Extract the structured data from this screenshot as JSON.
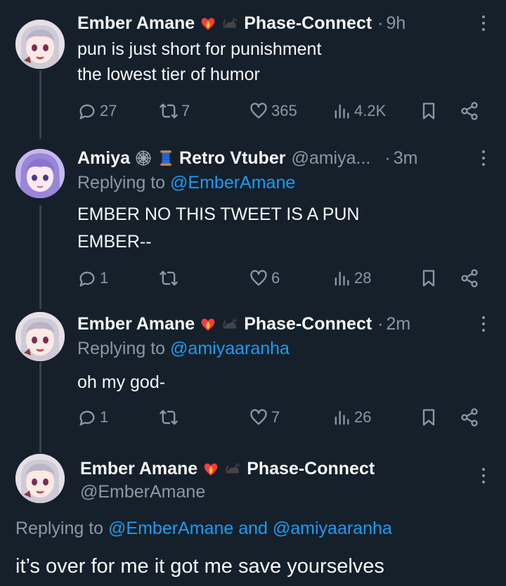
{
  "tweets": [
    {
      "name": "Ember Amane",
      "emojis": [
        "heart-fire-emoji",
        "black-cat-emoji"
      ],
      "name_suffix": "Phase-Connect",
      "handle": "",
      "time": "9h",
      "replying_to": null,
      "lines": [
        "pun is just short for punishment",
        "the lowest tier of humor"
      ],
      "stats": {
        "replies": "27",
        "retweets": "7",
        "likes": "365",
        "views": "4.2K"
      }
    },
    {
      "name": "Amiya",
      "emojis": [
        "spider-web-emoji",
        "thread-spool-emoji"
      ],
      "name_suffix": "Retro Vtuber",
      "handle": "@amiya...",
      "time": "3m",
      "replying_to": "@EmberAmane",
      "lines": [
        "EMBER NO THIS TWEET IS A PUN",
        "EMBER--"
      ],
      "stats": {
        "replies": "1",
        "retweets": "",
        "likes": "6",
        "views": "28"
      }
    },
    {
      "name": "Ember Amane",
      "emojis": [
        "heart-fire-emoji",
        "black-cat-emoji"
      ],
      "name_suffix": "Phase-Connect",
      "handle": "",
      "time": "2m",
      "replying_to": "@amiyaaranha",
      "lines": [
        "oh my god-"
      ],
      "stats": {
        "replies": "1",
        "retweets": "",
        "likes": "7",
        "views": "26"
      }
    }
  ],
  "main_tweet": {
    "name": "Ember Amane",
    "emojis": [
      "heart-fire-emoji",
      "black-cat-emoji"
    ],
    "name_suffix": "Phase-Connect",
    "handle": "@EmberAmane",
    "replying_prefix": "Replying to ",
    "replying_mention_1": "@EmberAmane",
    "replying_and": " and ",
    "replying_mention_2": "@amiyaaranha",
    "text": "it’s over for me it got me save yourselves"
  },
  "ui": {
    "replying_to_label": "Replying to ",
    "dot": "·"
  },
  "colors": {
    "background": "#15202b",
    "text": "#f7f9f9",
    "secondary": "#8b98a5",
    "accent": "#1d9bf0",
    "thread_line": "#38444d"
  }
}
